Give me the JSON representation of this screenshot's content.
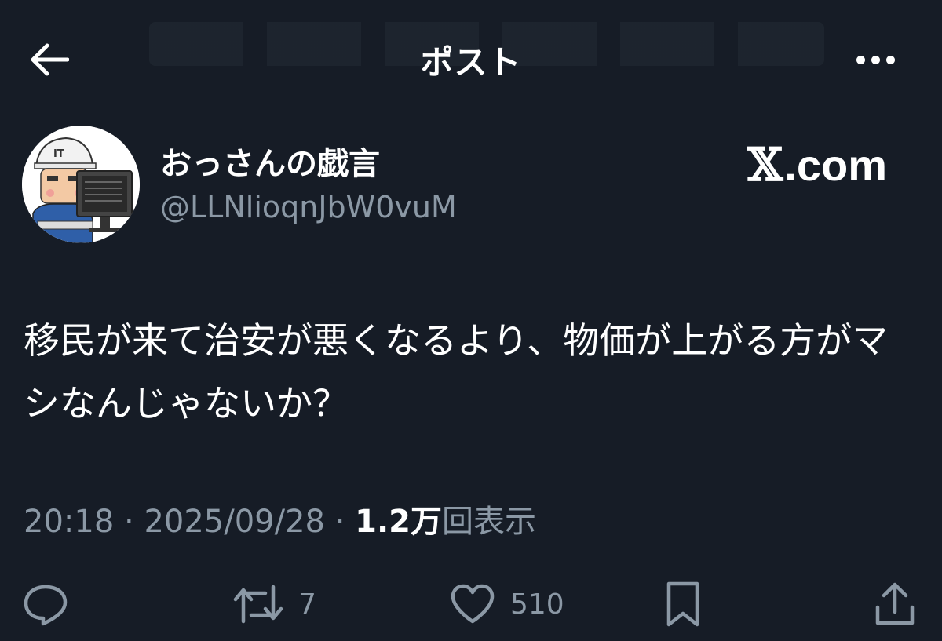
{
  "header": {
    "title": "ポスト",
    "back_icon": "arrow-left-icon",
    "more_icon": "more-horizontal-icon"
  },
  "author": {
    "display_name": "おっさんの戯言",
    "handle": "@LLNlioqnJbW0vuM",
    "avatar_icon": "it-worker-avatar"
  },
  "brand": {
    "x_glyph": "𝕏",
    "domain": ".com"
  },
  "post": {
    "text": "移民が来て治安が悪くなるより、物価が上がる方がマシなんじゃないか？"
  },
  "meta": {
    "time": "20:18",
    "separator1": " · ",
    "date": "2025/09/28",
    "separator2": " · ",
    "views_count": "1.2万",
    "views_label": "回表示"
  },
  "actions": {
    "reply": {
      "icon": "reply-icon",
      "count": ""
    },
    "repost": {
      "icon": "repost-icon",
      "count": "7"
    },
    "like": {
      "icon": "heart-icon",
      "count": "510"
    },
    "bookmark": {
      "icon": "bookmark-icon",
      "count": ""
    },
    "share": {
      "icon": "share-icon",
      "count": ""
    }
  },
  "colors": {
    "background": "#161c26",
    "text_primary": "#ffffff",
    "text_secondary": "#8b98a5"
  }
}
